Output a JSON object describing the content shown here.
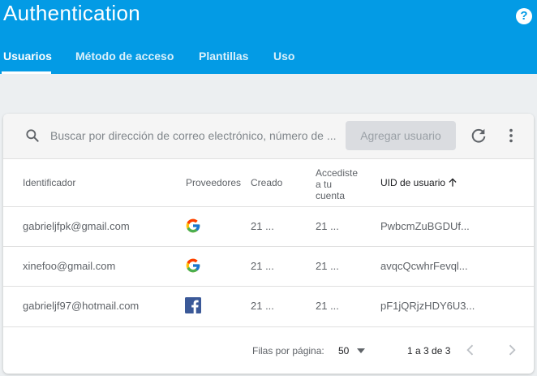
{
  "header": {
    "title": "Authentication",
    "help_icon": "help-icon",
    "tabs": [
      {
        "label": "Usuarios",
        "active": true
      },
      {
        "label": "Método de acceso",
        "active": false
      },
      {
        "label": "Plantillas",
        "active": false
      },
      {
        "label": "Uso",
        "active": false
      }
    ]
  },
  "toolbar": {
    "search_placeholder": "Buscar por dirección de correo electrónico, número de ...",
    "search_value": "",
    "add_button": "Agregar usuario",
    "icons": [
      "search-icon",
      "refresh-icon",
      "more-vert-icon"
    ]
  },
  "table": {
    "columns": {
      "identifier": "Identificador",
      "providers": "Proveedores",
      "created": "Creado",
      "signed_in_1": "Accediste",
      "signed_in_2": "a tu",
      "signed_in_3": "cuenta",
      "uid": "UID de usuario",
      "uid_sort": "ascending"
    },
    "rows": [
      {
        "identifier": "gabrieljfpk@gmail.com",
        "provider": "google",
        "created": "21 ...",
        "signed_in": "21 ...",
        "uid": "PwbcmZuBGDUf..."
      },
      {
        "identifier": "xinefoo@gmail.com",
        "provider": "google",
        "created": "21 ...",
        "signed_in": "21 ...",
        "uid": "avqcQcwhrFevql..."
      },
      {
        "identifier": "gabrieljf97@hotmail.com",
        "provider": "facebook",
        "created": "21 ...",
        "signed_in": "21 ...",
        "uid": "pF1jQRjzHDY6U3..."
      }
    ]
  },
  "footer": {
    "rows_per_page_label": "Filas por página:",
    "rows_per_page_value": "50",
    "range": "1 a 3 de 3"
  },
  "colors": {
    "header_bg": "#039be5",
    "page_bg": "#eceff1",
    "button_disabled": "#dadce0"
  }
}
